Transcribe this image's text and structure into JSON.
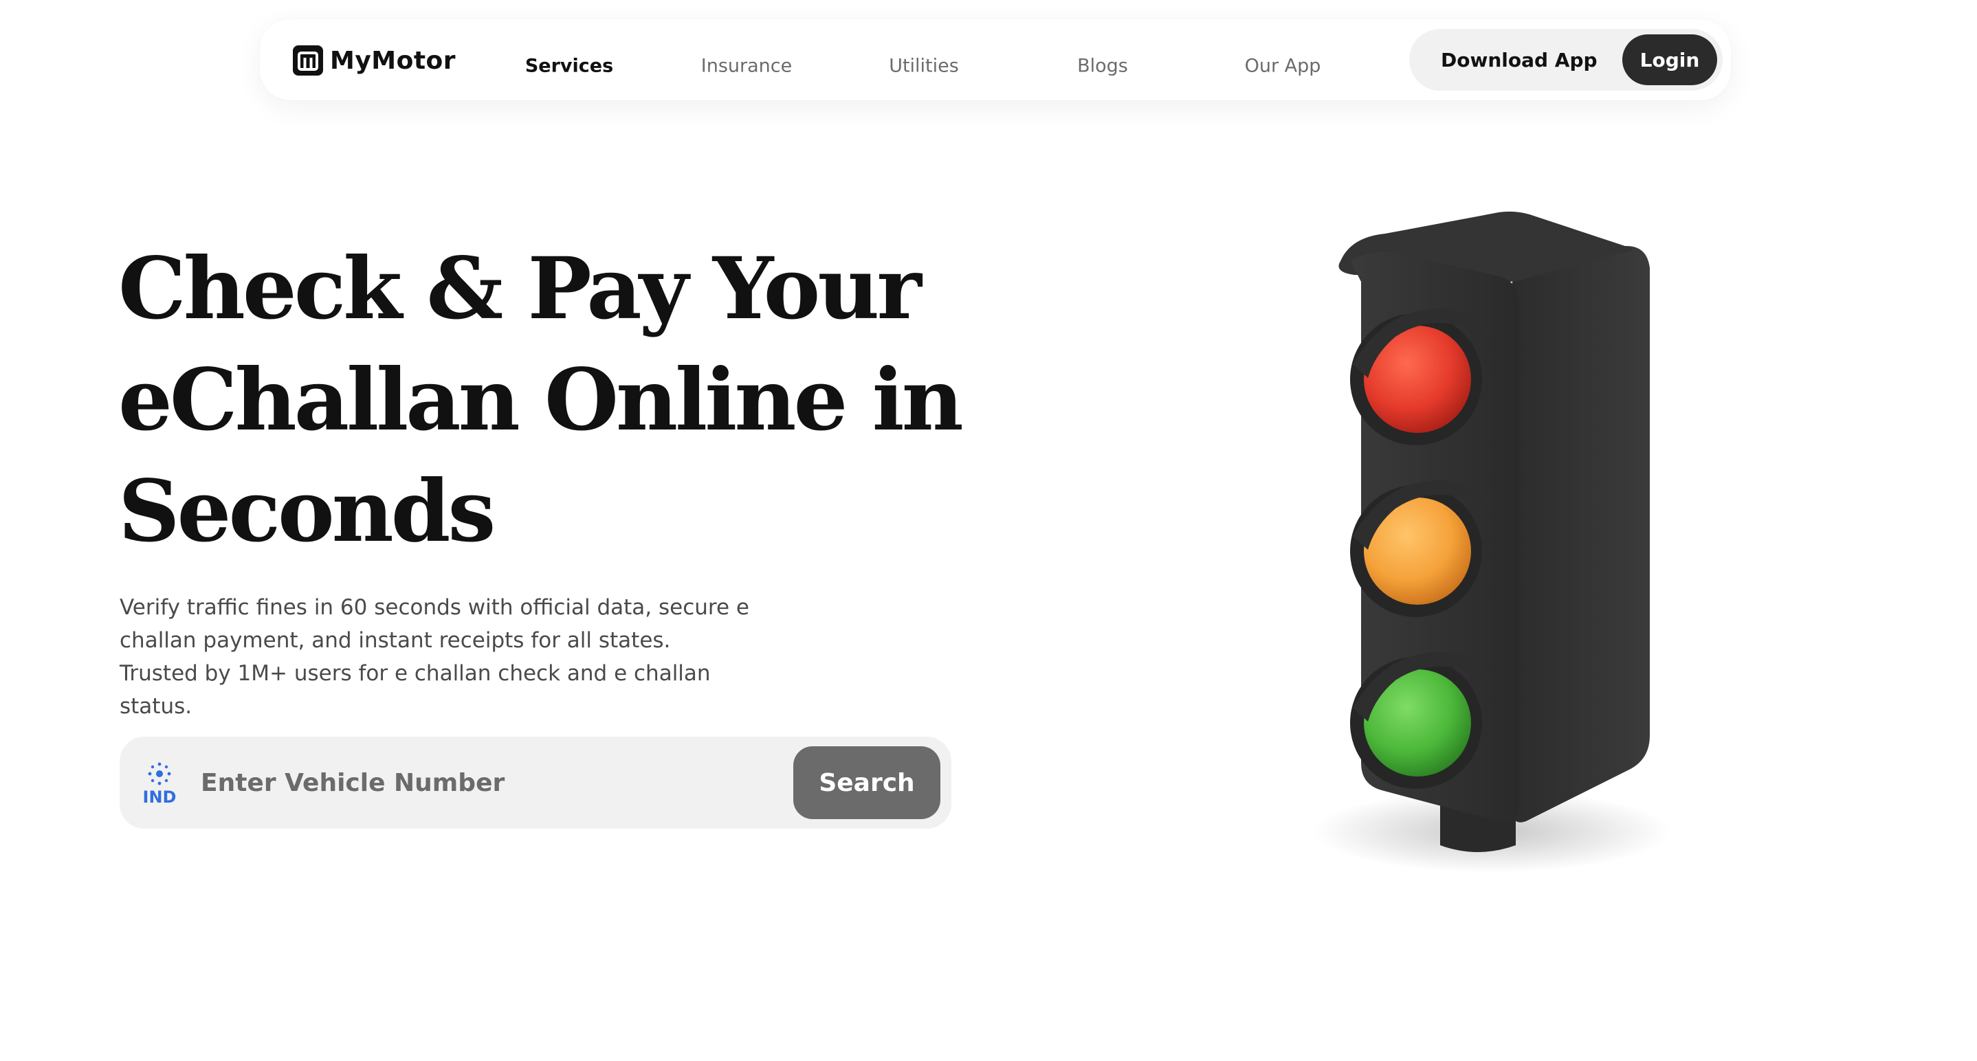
{
  "brand": {
    "name": "MyMotor",
    "logo_icon": "mymotor-logo-icon"
  },
  "nav": {
    "links": [
      {
        "label": "Services",
        "active": true
      },
      {
        "label": "Insurance",
        "active": false
      },
      {
        "label": "Utilities",
        "active": false
      },
      {
        "label": "Blogs",
        "active": false
      },
      {
        "label": "Our App",
        "active": false
      }
    ],
    "download_label": "Download App",
    "login_label": "Login"
  },
  "hero": {
    "title_lines": [
      "Check & Pay Your",
      "eChallan Online in",
      "Seconds"
    ],
    "description": "Verify traffic fines in 60 seconds with official data, secure e challan payment, and instant receipts for all states. Trusted by 1M+ users for e challan check and e challan status."
  },
  "search": {
    "country_badge": "IND",
    "country_icon": "ashoka-chakra-icon",
    "placeholder": "Enter Vehicle Number",
    "value": "",
    "button_label": "Search"
  },
  "illustration": {
    "name": "traffic-light-illustration",
    "lights": [
      "red",
      "amber",
      "green"
    ]
  },
  "colors": {
    "text": "#111111",
    "muted": "#6b6b6b",
    "login_bg": "#2b2b2b",
    "search_bg": "#f1f1f1",
    "search_button": "#6b6b6b",
    "ind_blue": "#2f6fe0",
    "light_red": "#e53b2c",
    "light_amber": "#f5a23a",
    "light_green": "#4cb83a"
  }
}
